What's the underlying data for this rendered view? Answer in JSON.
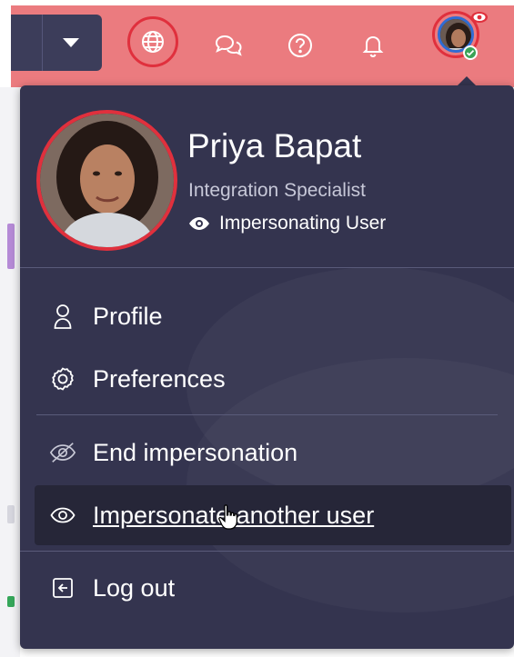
{
  "user": {
    "name": "Priya Bapat",
    "role": "Integration Specialist",
    "status": "Impersonating User"
  },
  "menu": {
    "items": [
      {
        "label": "Profile",
        "icon": "person-icon"
      },
      {
        "label": "Preferences",
        "icon": "gear-icon"
      },
      {
        "label": "End impersonation",
        "icon": "eye-slash-icon"
      },
      {
        "label": "Impersonate another user",
        "icon": "eye-icon",
        "state": "hovered"
      },
      {
        "label": "Log out",
        "icon": "logout-icon"
      }
    ]
  },
  "topbar": {
    "icons": [
      "globe-icon",
      "chat-icon",
      "help-icon",
      "bell-icon"
    ],
    "accent_color": "#eb7b7f",
    "highlight_color": "#e0303d"
  },
  "theme": {
    "panel_bg": "#34344f",
    "hover_bg": "#262638",
    "online_color": "#3aa356"
  }
}
